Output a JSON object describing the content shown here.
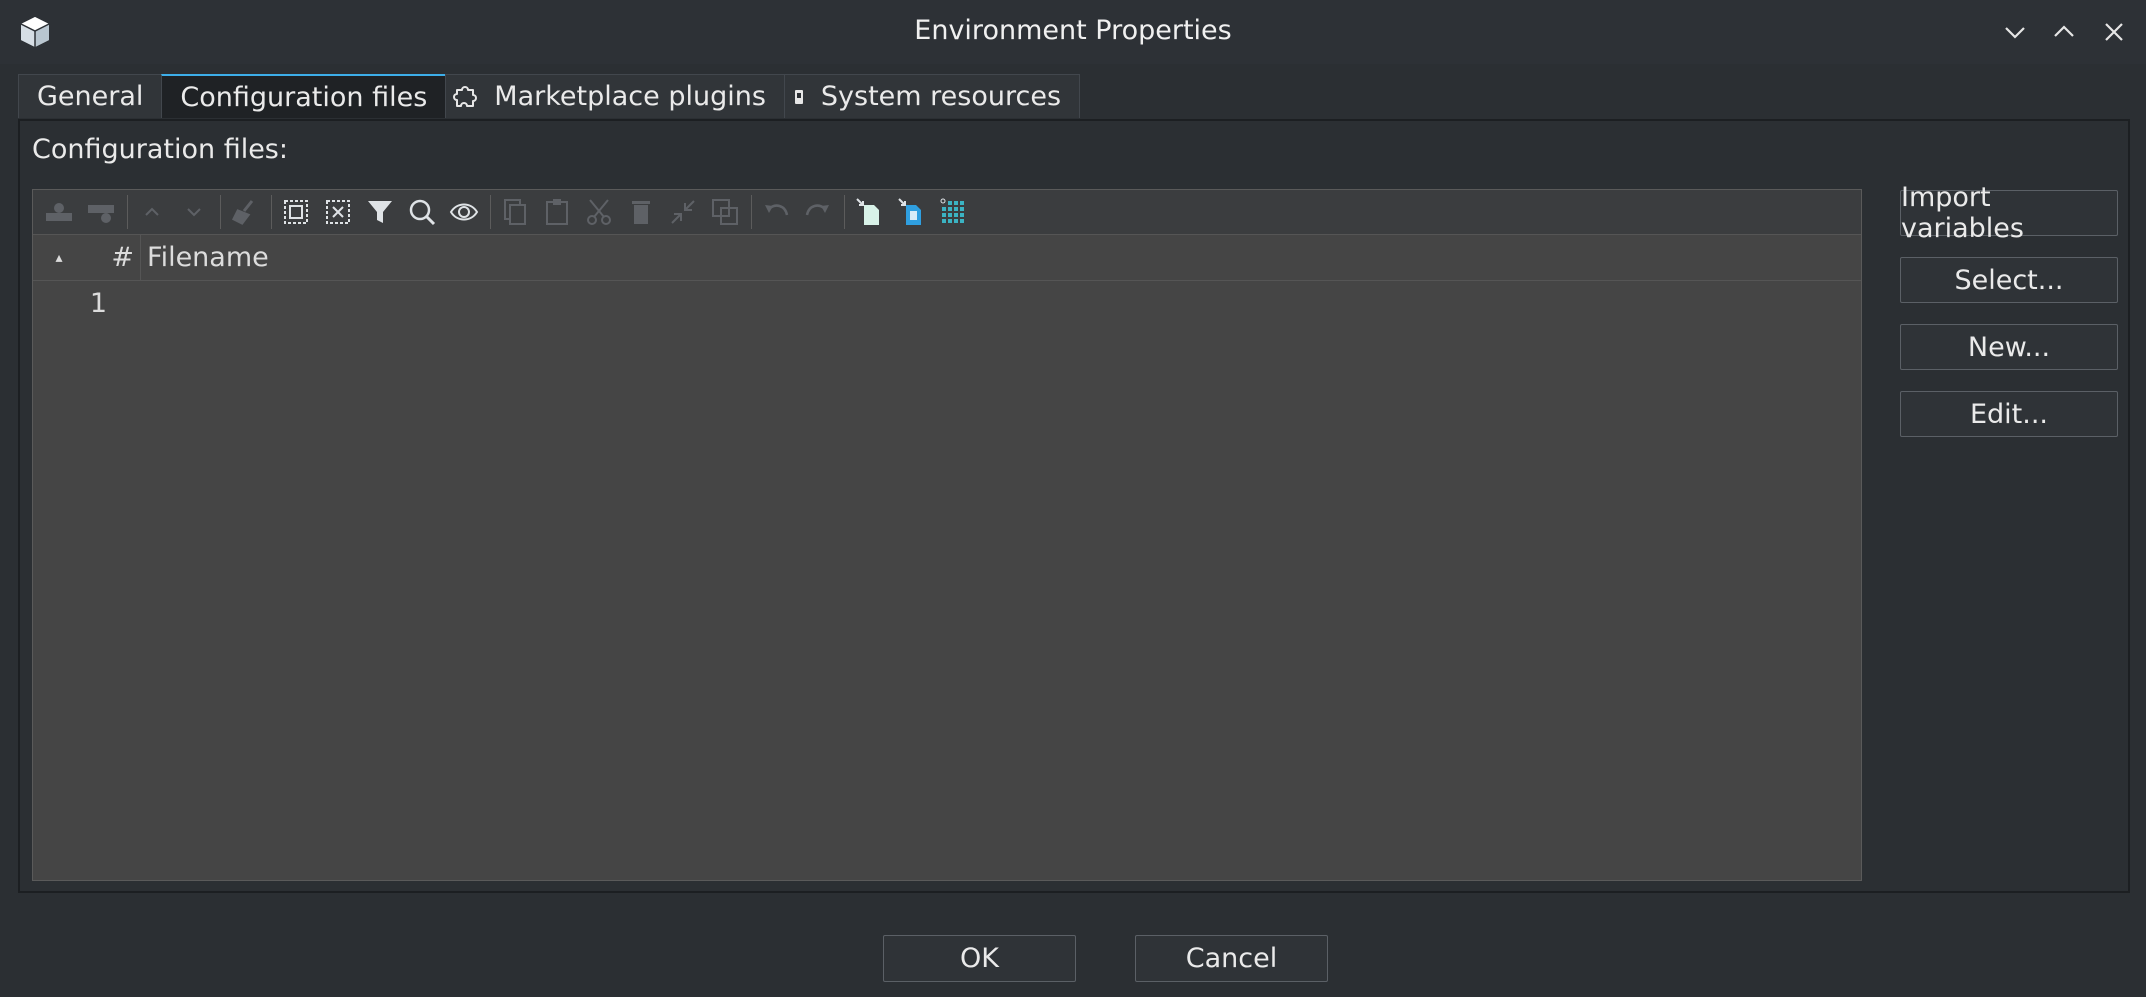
{
  "window": {
    "title": "Environment Properties",
    "icons": {
      "app": "cube-icon",
      "minimize": "chevron-down-icon",
      "maximize": "chevron-up-icon",
      "close": "close-icon"
    }
  },
  "tabs": [
    {
      "label": "General",
      "active": false
    },
    {
      "label": "Configuration files",
      "active": true
    },
    {
      "label": "Marketplace plugins",
      "icon": "puzzle-icon",
      "active": false
    },
    {
      "label": "System resources",
      "icon": "memory-icon",
      "active": false
    }
  ],
  "panel": {
    "label": "Configuration files:"
  },
  "toolbar": {
    "icons": [
      "add-row-icon",
      "remove-row-icon",
      "move-up-icon",
      "move-down-icon",
      "clear-icon",
      "select-all-icon",
      "deselect-icon",
      "filter-icon",
      "search-icon",
      "eye-icon",
      "copy-icon",
      "paste-icon",
      "cut-icon",
      "delete-icon",
      "collapse-icon",
      "duplicate-icon",
      "undo-icon",
      "redo-icon",
      "import-icon",
      "export-icon",
      "grid-icon"
    ]
  },
  "table": {
    "columns": {
      "sort": "▴",
      "number": "#",
      "filename": "Filename"
    },
    "rows": [
      {
        "number": "1",
        "filename": ""
      }
    ]
  },
  "side_buttons": {
    "import_variables": "Import variables",
    "select": "Select...",
    "new": "New...",
    "edit": "Edit..."
  },
  "dialog_buttons": {
    "ok": "OK",
    "cancel": "Cancel"
  },
  "colors": {
    "accent": "#3daee9",
    "toolbar_icon_active": "#dfe3e6",
    "toolbar_icon_disabled": "#5e6166",
    "grid_icon": "#3bb3c3"
  }
}
